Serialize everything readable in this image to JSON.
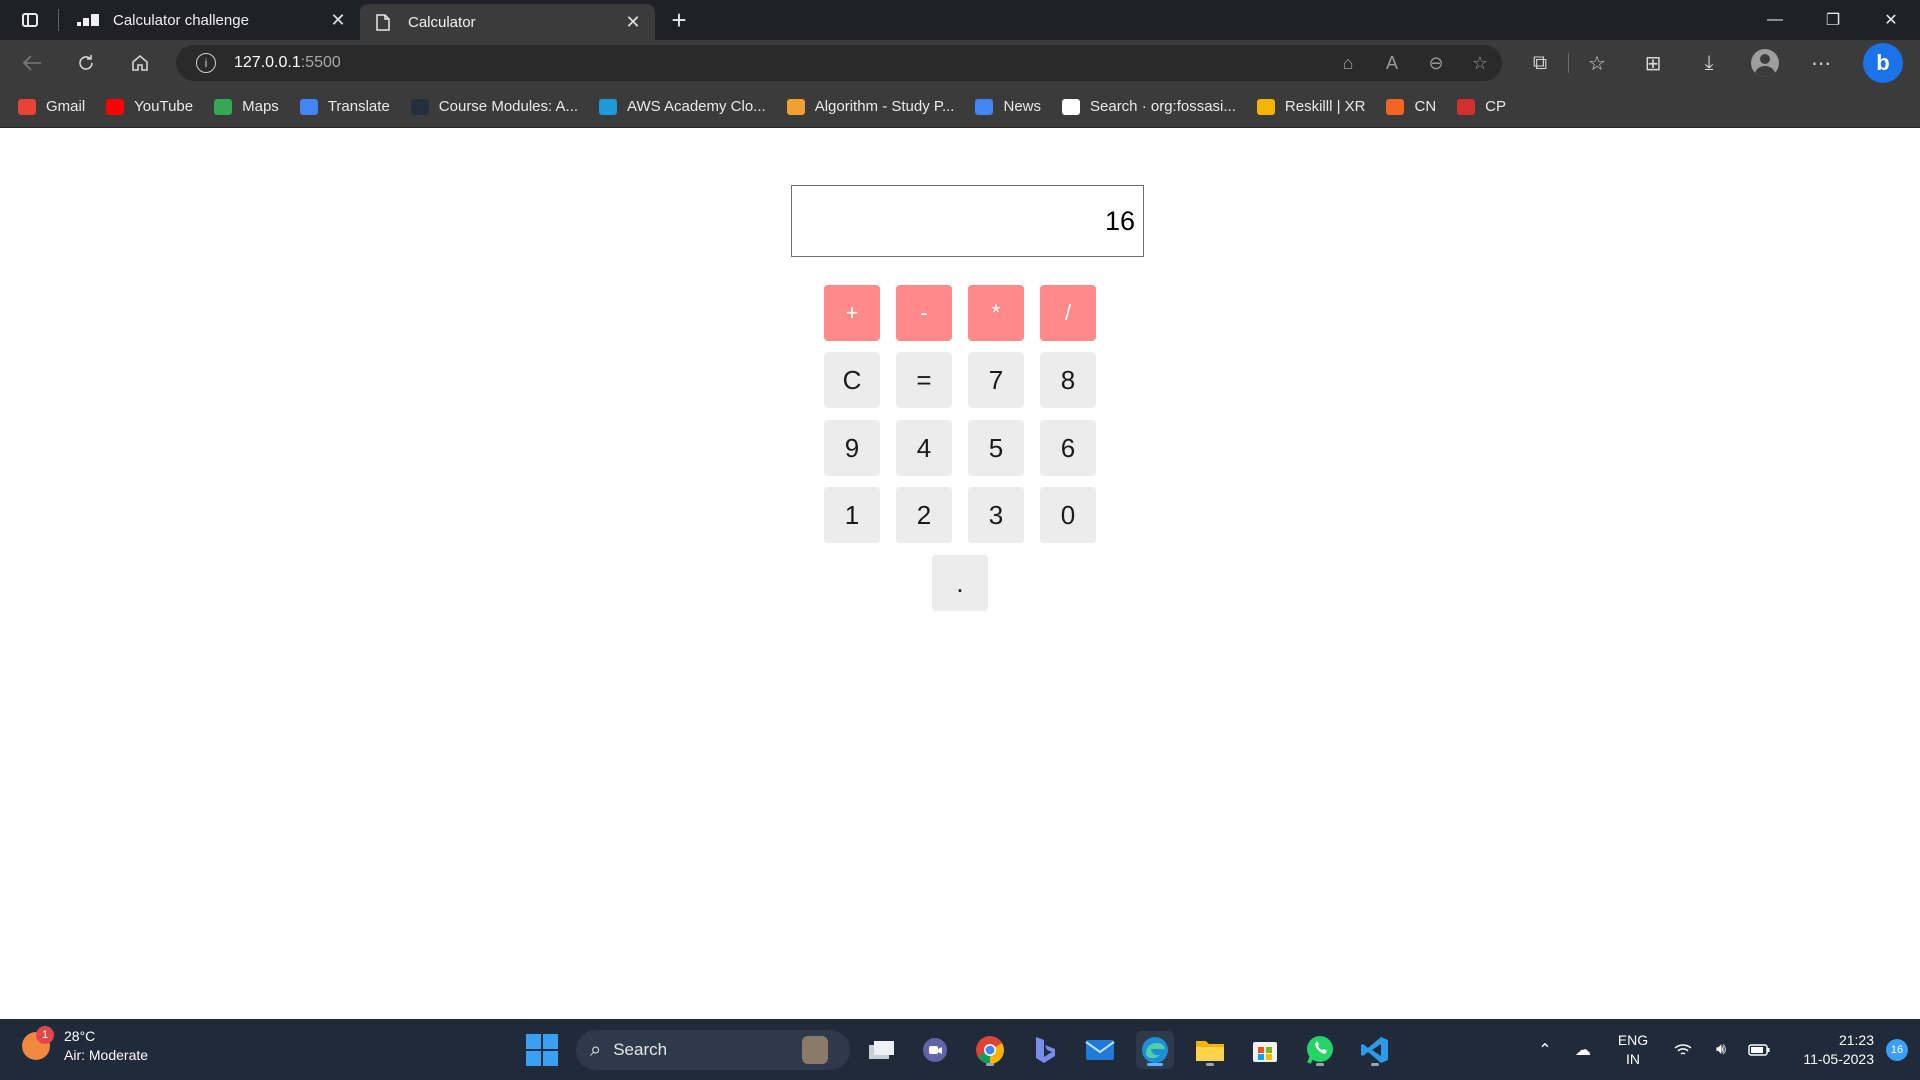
{
  "browser": {
    "tabs": [
      {
        "label": "Calculator challenge",
        "active": false
      },
      {
        "label": "Calculator",
        "active": true
      }
    ],
    "address": {
      "host": "127.0.0.1",
      "port": ":5500"
    },
    "bookmarks": [
      {
        "label": "Gmail",
        "icon": "gmail-icon",
        "color": "#ea4335"
      },
      {
        "label": "YouTube",
        "icon": "youtube-icon",
        "color": "#ff0000"
      },
      {
        "label": "Maps",
        "icon": "maps-icon",
        "color": "#34a853"
      },
      {
        "label": "Translate",
        "icon": "translate-icon",
        "color": "#4285f4"
      },
      {
        "label": "Course Modules: A...",
        "icon": "aws-icon",
        "color": "#232f3e"
      },
      {
        "label": "AWS Academy Clo...",
        "icon": "cloud-icon",
        "color": "#1b9bd7"
      },
      {
        "label": "Algorithm - Study P...",
        "icon": "leetcode-icon",
        "color": "#f0a030"
      },
      {
        "label": "News",
        "icon": "news-icon",
        "color": "#4285f4"
      },
      {
        "label": "Search · org:fossasi...",
        "icon": "github-icon",
        "color": "#ffffff"
      },
      {
        "label": "Reskilll | XR",
        "icon": "bulb-icon",
        "color": "#f5b400"
      },
      {
        "label": "CN",
        "icon": "cn-icon",
        "color": "#f26522"
      },
      {
        "label": "CP",
        "icon": "cp-icon",
        "color": "#d32f2f"
      }
    ]
  },
  "calculator": {
    "display": "16",
    "operators": [
      "+",
      "-",
      "*",
      "/"
    ],
    "row2": [
      "C",
      "=",
      "7",
      "8"
    ],
    "row3": [
      "9",
      "4",
      "5",
      "6"
    ],
    "row4": [
      "1",
      "2",
      "3",
      "0"
    ],
    "decimal": ".",
    "operator_color": "#ff8a8a",
    "key_color": "#ececec"
  },
  "taskbar": {
    "weather": {
      "badge": "1",
      "temp": "28°C",
      "condition": "Air: Moderate"
    },
    "search_label": "Search",
    "language": {
      "line1": "ENG",
      "line2": "IN"
    },
    "clock": {
      "time": "21:23",
      "date": "11-05-2023"
    },
    "notifications": "16"
  }
}
